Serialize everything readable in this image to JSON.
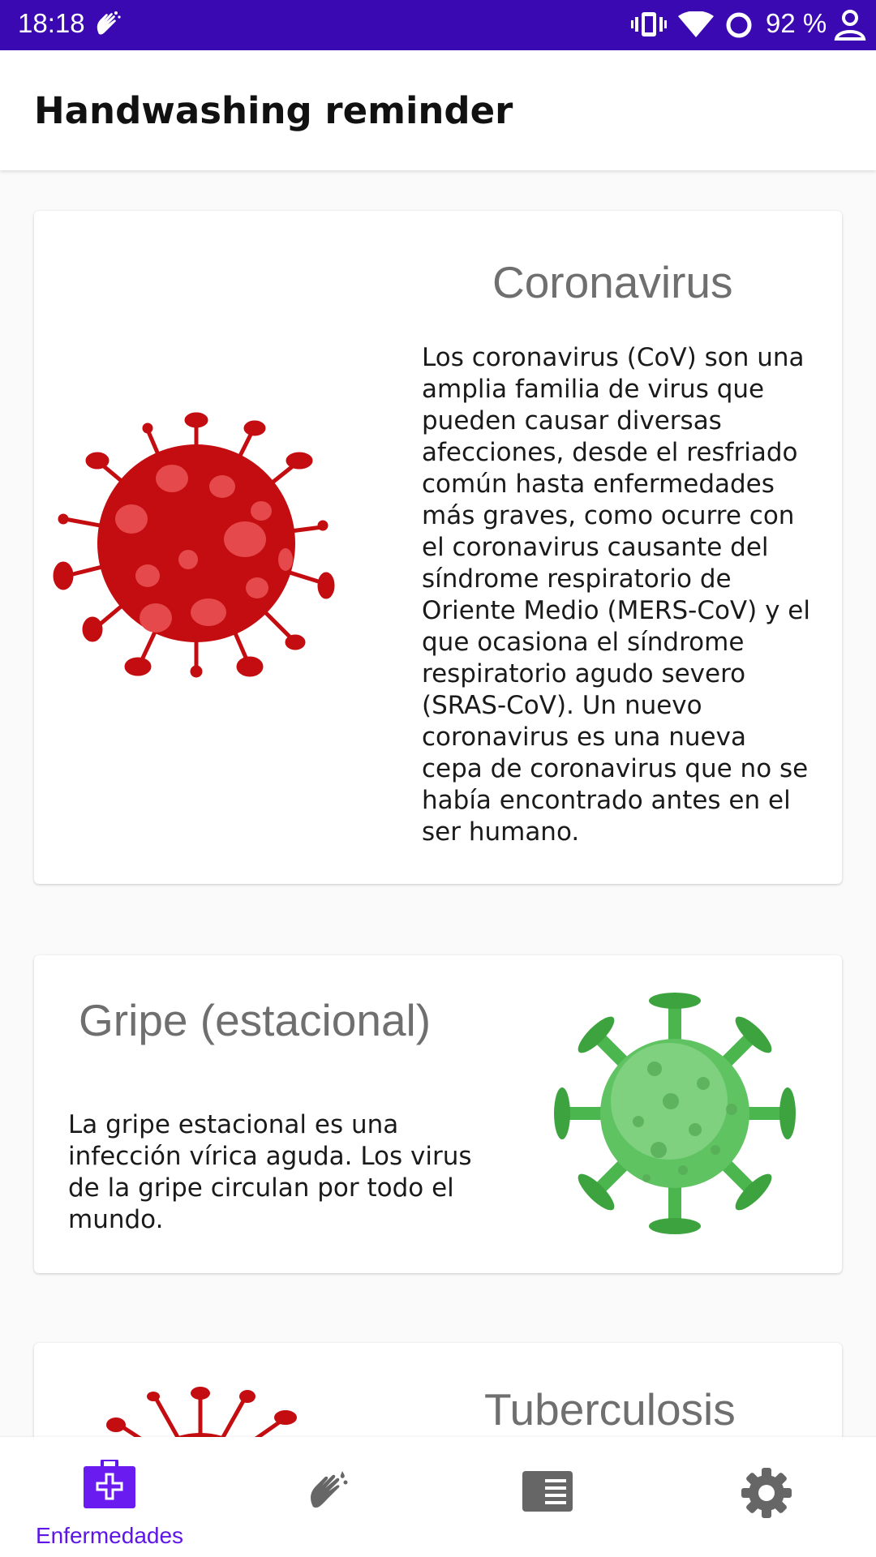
{
  "status_bar": {
    "time": "18:18",
    "battery": "92 %"
  },
  "app_bar": {
    "title": "Handwashing reminder"
  },
  "diseases": [
    {
      "title": "Coronavirus",
      "description": "Los coronavirus (CoV) son una amplia familia de virus que pueden causar diversas afecciones, desde el resfriado común hasta enfermedades más graves, como ocurre con el coronavirus causante del síndrome respiratorio de Oriente Medio (MERS-CoV) y el que ocasiona el síndrome respiratorio agudo severo (SRAS-CoV). Un nuevo coronavirus es una nueva cepa de coronavirus que no se había encontrado antes en el ser humano.",
      "image_color": "#c40d10"
    },
    {
      "title": "Gripe (estacional)",
      "description": "La gripe estacional es una infección vírica aguda. Los virus de la gripe circulan por todo el mundo.",
      "image_color": "#4cb64e"
    },
    {
      "title": "Tuberculosis",
      "image_color": "#c40d10"
    }
  ],
  "bottom_nav": {
    "items": [
      {
        "label": "Enfermedades",
        "icon": "medical-kit-icon",
        "selected": true
      },
      {
        "icon": "handwash-icon"
      },
      {
        "icon": "article-icon"
      },
      {
        "icon": "gear-icon"
      }
    ],
    "accent": "#5e15e8"
  }
}
